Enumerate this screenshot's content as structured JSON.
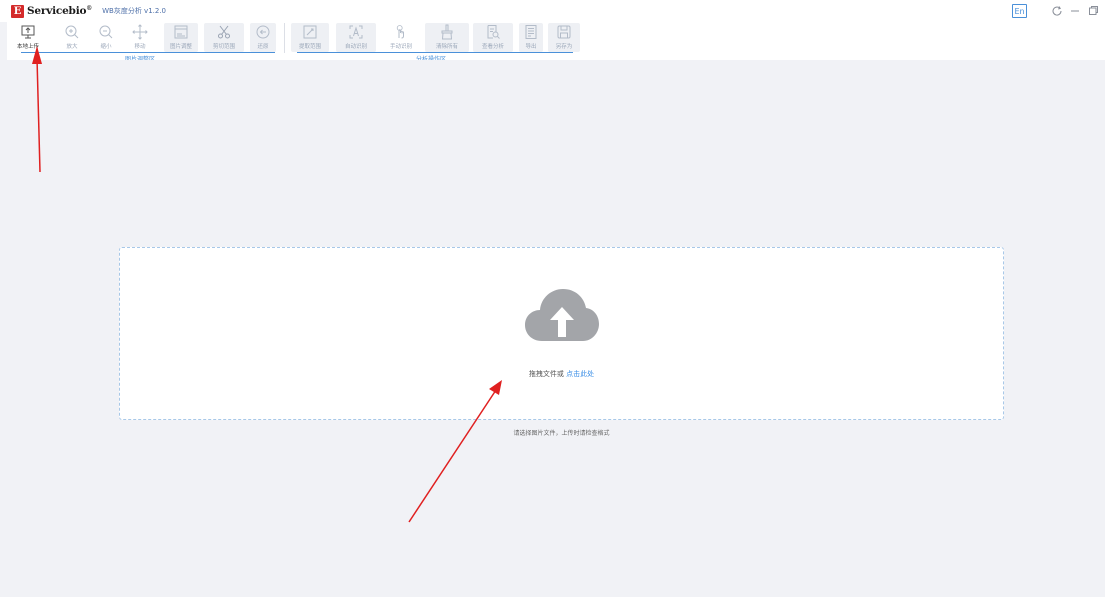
{
  "titlebar": {
    "logo_mark": "E",
    "brand": "Servicebio",
    "brand_sup": "®",
    "app_version": "WB灰度分析 v1.2.0",
    "lang_button": "En"
  },
  "toolbar": {
    "tools": [
      {
        "label": "本地上传",
        "icon": "upload-icon",
        "active": true
      },
      {
        "label": "放大",
        "icon": "zoom-in-icon"
      },
      {
        "label": "缩小",
        "icon": "zoom-out-icon"
      },
      {
        "label": "移动",
        "icon": "move-icon"
      },
      {
        "label": "图片调整",
        "icon": "image-adjust-icon"
      },
      {
        "label": "剪切范围",
        "icon": "scissors-icon"
      },
      {
        "label": "还原",
        "icon": "restore-icon"
      },
      {
        "label": "提取范围",
        "icon": "extract-icon"
      },
      {
        "label": "自动识别",
        "icon": "auto-detect-icon"
      },
      {
        "label": "手动识别",
        "icon": "manual-detect-icon"
      },
      {
        "label": "清除所有",
        "icon": "clear-all-icon"
      },
      {
        "label": "查看分析",
        "icon": "view-analysis-icon"
      },
      {
        "label": "导出",
        "icon": "export-icon"
      },
      {
        "label": "另存为",
        "icon": "save-as-icon"
      }
    ],
    "groups": {
      "image_adjust": "图片调整区",
      "analysis_ops": "分析操作区"
    }
  },
  "dropzone": {
    "text": "拖拽文件或",
    "link": "点击此处",
    "hint": "请选择图片文件，上传时请检查格式"
  },
  "colors": {
    "accent": "#4a90d9",
    "brand_red": "#d42a2a",
    "annotation_arrow": "#e02020",
    "cloud_gray": "#a3a5a9"
  }
}
